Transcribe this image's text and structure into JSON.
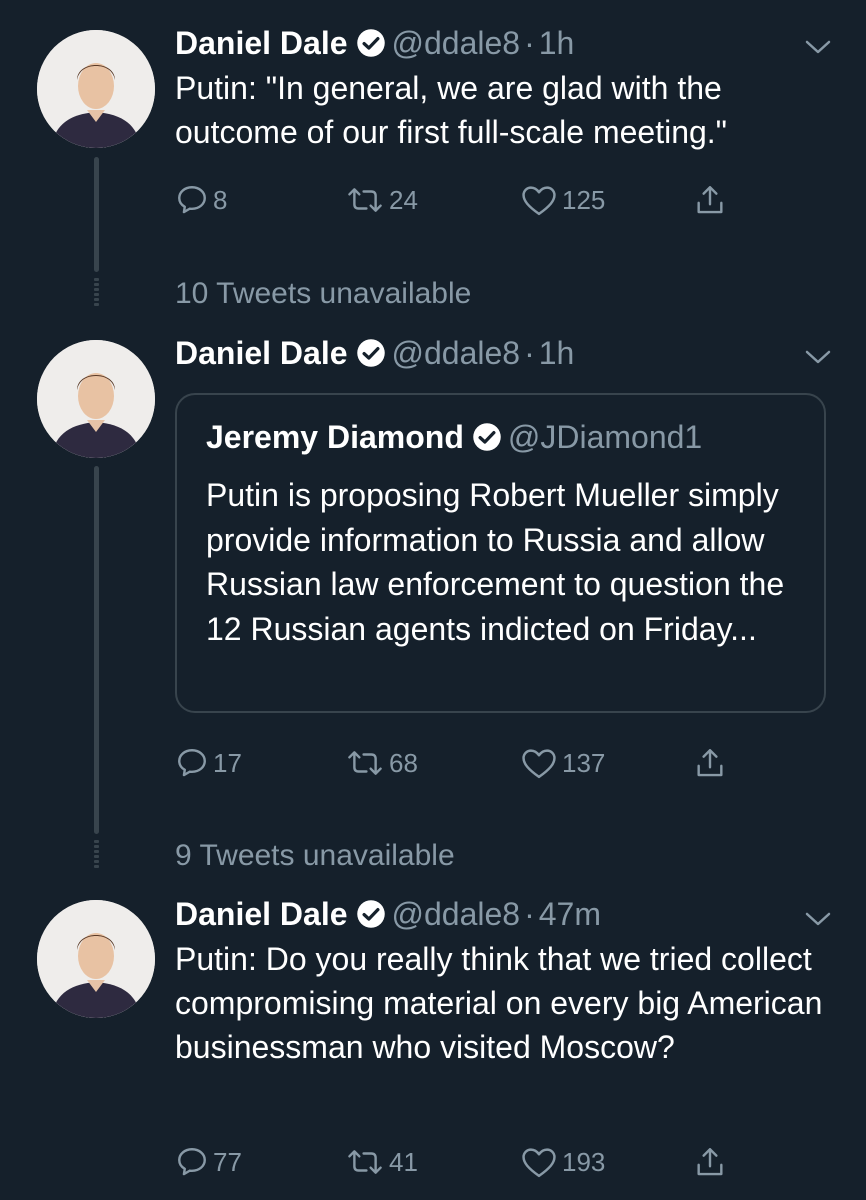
{
  "tweets": [
    {
      "name": "Daniel Dale",
      "handle": "@ddale8",
      "sep": "·",
      "time": "1h",
      "text": "Putin: \"In general, we are glad with the outcome of our first full-scale meeting.\"",
      "replies": "8",
      "retweets": "24",
      "likes": "125"
    },
    {
      "name": "Daniel Dale",
      "handle": "@ddale8",
      "sep": "·",
      "time": "1h",
      "quote": {
        "name": "Jeremy Diamond",
        "handle": "@JDiamond1",
        "text": "Putin is proposing Robert Mueller simply provide information to Russia and allow Russian law enforcement to question the 12 Russian agents indicted on Friday..."
      },
      "replies": "17",
      "retweets": "68",
      "likes": "137"
    },
    {
      "name": "Daniel Dale",
      "handle": "@ddale8",
      "sep": "·",
      "time": "47m",
      "text": "Putin: Do you really think that we tried collect compromising material on every big American businessman who visited Moscow?",
      "replies": "77",
      "retweets": "41",
      "likes": "193"
    }
  ],
  "unavailable": [
    "10 Tweets unavailable",
    "9 Tweets unavailable"
  ],
  "colors": {
    "background": "#15202b",
    "text": "#ffffff",
    "secondary": "#8899a6",
    "line": "#38444d"
  },
  "icons": [
    "reply-icon",
    "retweet-icon",
    "like-icon",
    "share-icon",
    "verified-icon",
    "chevron-down-icon"
  ]
}
